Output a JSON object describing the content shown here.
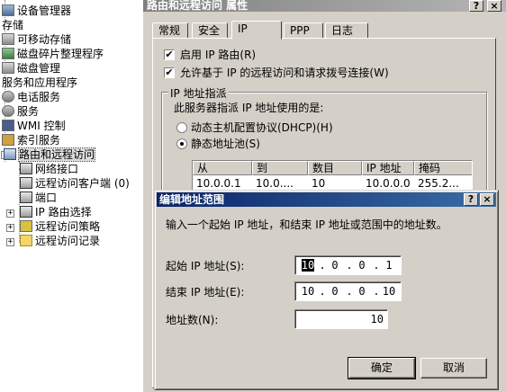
{
  "tree": {
    "items": [
      {
        "label": "设备管理器"
      },
      {
        "label": "存储"
      },
      {
        "label": "可移动存储"
      },
      {
        "label": "磁盘碎片整理程序"
      },
      {
        "label": "磁盘管理"
      },
      {
        "label": "服务和应用程序"
      },
      {
        "label": "电话服务"
      },
      {
        "label": "服务"
      },
      {
        "label": "WMI 控制"
      },
      {
        "label": "索引服务"
      },
      {
        "label": "路由和远程访问"
      },
      {
        "label": "网络接口"
      },
      {
        "label": "远程访问客户端 (0)"
      },
      {
        "label": "端口"
      },
      {
        "label": "IP 路由选择"
      },
      {
        "label": "远程访问策略"
      },
      {
        "label": "远程访问记录"
      }
    ],
    "expand_plus": "+",
    "expand_minus": "-"
  },
  "props": {
    "title": "路由和远程访问 属性",
    "help_btn": "?",
    "close_btn": "×",
    "tabs": [
      {
        "label": "常规"
      },
      {
        "label": "安全"
      },
      {
        "label": "IP"
      },
      {
        "label": "PPP"
      },
      {
        "label": "日志"
      }
    ],
    "active_tab": "IP",
    "enable_ip_routing": {
      "label": "启用 IP 路由(R)",
      "checked": true
    },
    "allow_ip_remote": {
      "label": "允许基于 IP 的远程访问和请求拨号连接(W)",
      "checked": true
    },
    "assign_group": {
      "label": "IP 地址指派",
      "desc": "此服务器指派 IP 地址使用的是:",
      "dhcp": {
        "label": "动态主机配置协议(DHCP)(H)",
        "selected": false
      },
      "static": {
        "label": "静态地址池(S)",
        "selected": true
      }
    },
    "pool_table": {
      "headers": [
        "从",
        "到",
        "数目",
        "IP 地址",
        "掩码"
      ],
      "rows": [
        [
          "10.0.0.1",
          "10.0....",
          "10",
          "10.0.0.0",
          "255.2..."
        ]
      ]
    },
    "check_mark": "✔"
  },
  "dialog": {
    "title": "编辑地址范围",
    "help_btn": "?",
    "close_btn": "×",
    "instruction": "输入一个起始 IP 地址，和结束 IP 地址或范围中的地址数。",
    "start_ip": {
      "label": "起始 IP 地址(S):",
      "octets": [
        "10",
        "0",
        "0",
        "1"
      ]
    },
    "end_ip": {
      "label": "结束 IP 地址(E):",
      "octets": [
        "10",
        "0",
        "0",
        "10"
      ]
    },
    "count": {
      "label": "地址数(N):",
      "value": "10"
    },
    "ok_label": "确定",
    "cancel_label": "取消"
  },
  "colors": {
    "dialog_titlebar": "#0a246a",
    "inactive_titlebar": "#808080",
    "face": "#d4d0c8"
  }
}
